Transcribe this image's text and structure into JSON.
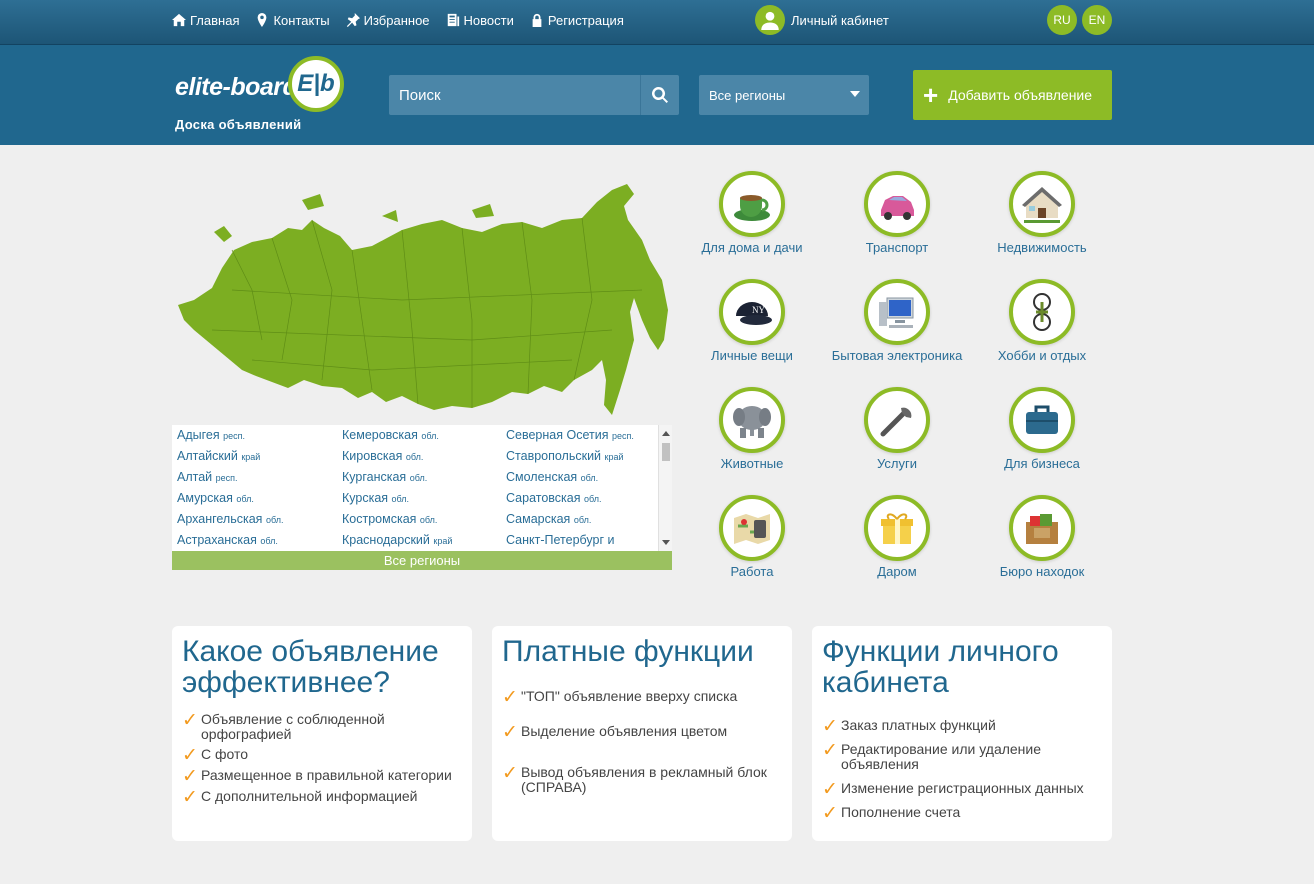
{
  "topnav": {
    "items": [
      {
        "label": "Главная",
        "icon": "home-icon"
      },
      {
        "label": "Контакты",
        "icon": "location-pin-icon"
      },
      {
        "label": "Избранное",
        "icon": "pin-icon"
      },
      {
        "label": "Новости",
        "icon": "news-icon"
      },
      {
        "label": "Регистрация",
        "icon": "lock-icon"
      }
    ],
    "cabinet_label": "Личный кабинет",
    "lang_ru": "RU",
    "lang_en": "EN"
  },
  "header": {
    "logo_text": "elite-board",
    "logo_badge": "E|b",
    "logo_sub": "Доска объявлений",
    "search_placeholder": "Поиск",
    "region_select": "Все регионы",
    "add_button": "Добавить объявление"
  },
  "colors": {
    "brand_blue": "#20678e",
    "brand_green": "#8dbb26",
    "check_orange": "#f29a1f"
  },
  "regions": {
    "col1": [
      {
        "name": "Адыгея",
        "type": "респ."
      },
      {
        "name": "Алтайский",
        "type": "край"
      },
      {
        "name": "Алтай",
        "type": "респ."
      },
      {
        "name": "Амурская",
        "type": "обл."
      },
      {
        "name": "Архангельская",
        "type": "обл."
      },
      {
        "name": "Астраханская",
        "type": "обл."
      }
    ],
    "col2": [
      {
        "name": "Кемеровская",
        "type": "обл."
      },
      {
        "name": "Кировская",
        "type": "обл."
      },
      {
        "name": "Курганская",
        "type": "обл."
      },
      {
        "name": "Курская",
        "type": "обл."
      },
      {
        "name": "Костромская",
        "type": "обл."
      },
      {
        "name": "Краснодарский",
        "type": "край"
      }
    ],
    "col3": [
      {
        "name": "Северная Осетия",
        "type": "респ."
      },
      {
        "name": "Ставропольский",
        "type": "край"
      },
      {
        "name": "Смоленская",
        "type": "обл."
      },
      {
        "name": "Саратовская",
        "type": "обл."
      },
      {
        "name": "Самарская",
        "type": "обл."
      },
      {
        "name": "Санкт-Петербург и",
        "type": ""
      }
    ],
    "all_label": "Все регионы"
  },
  "categories": [
    {
      "label": "Для дома и дачи",
      "icon": "teacup-icon"
    },
    {
      "label": "Транспорт",
      "icon": "car-icon"
    },
    {
      "label": "Недвижимость",
      "icon": "house-icon"
    },
    {
      "label": "Личные вещи",
      "icon": "cap-icon"
    },
    {
      "label": "Бытовая электроника",
      "icon": "computer-icon"
    },
    {
      "label": "Хобби и отдых",
      "icon": "bicycle-icon"
    },
    {
      "label": "Животные",
      "icon": "elephant-icon"
    },
    {
      "label": "Услуги",
      "icon": "wrench-icon"
    },
    {
      "label": "Для бизнеса",
      "icon": "briefcase-icon"
    },
    {
      "label": "Работа",
      "icon": "map-phone-icon"
    },
    {
      "label": "Даром",
      "icon": "gift-icon"
    },
    {
      "label": "Бюро находок",
      "icon": "box-icon"
    }
  ],
  "boxes": [
    {
      "title": "Какое объявление эффективнее?",
      "items": [
        "Объявление с соблюденной орфографией",
        "С фото",
        "Размещенное в правильной категории",
        "С дополнительной информацией"
      ]
    },
    {
      "title": "Платные функции",
      "items": [
        "\"ТОП\" объявление вверху списка",
        "Выделение объявления цветом",
        "Вывод объявления в рекламный блок (СПРАВА)"
      ]
    },
    {
      "title": "Функции личного кабинета",
      "items": [
        "Заказ платных функций",
        "Редактирование или удаление объявления",
        "Изменение регистрационных данных",
        "Пополнение счета"
      ]
    }
  ],
  "check_glyph": "✓"
}
